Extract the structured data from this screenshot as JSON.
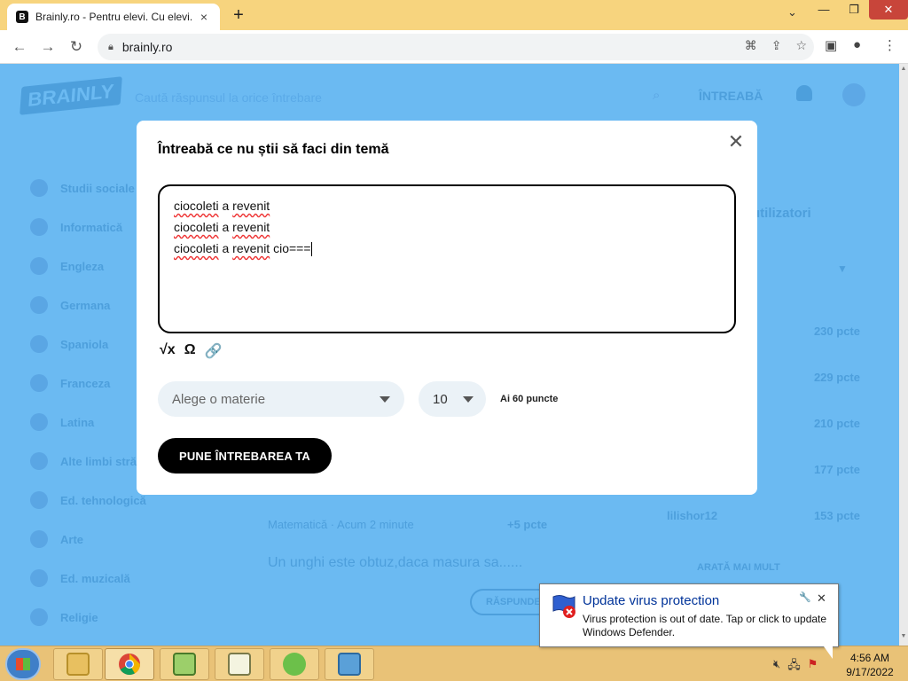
{
  "browser": {
    "tab_title": "Brainly.ro - Pentru elevi. Cu elevi.",
    "tab_favicon": "B",
    "tab_close": "×",
    "new_tab": "+",
    "url": "brainly.ro",
    "window_controls": {
      "minimize": "—",
      "restore": "❐",
      "close": "✕"
    },
    "tab_dropdown": "⌄",
    "nav": {
      "back": "←",
      "forward": "→",
      "reload": "↻"
    },
    "omni_icons": {
      "translate": "⌘",
      "share": "⇪",
      "bookmark": "☆"
    },
    "right_icons": {
      "sidepanel": "▣",
      "profile": "●",
      "menu": "⋮"
    }
  },
  "page": {
    "logo": "BRAINLY",
    "search_placeholder": "Caută răspunsul la orice întrebare",
    "ask_button": "ÎNTREABĂ",
    "subjects": [
      {
        "label": "Studii sociale",
        "icon": "social-icon"
      },
      {
        "label": "Informatică",
        "icon": "computer-icon"
      },
      {
        "label": "Engleza",
        "icon": "english-icon"
      },
      {
        "label": "Germana",
        "icon": "german-icon"
      },
      {
        "label": "Spaniola",
        "icon": "spanish-icon"
      },
      {
        "label": "Franceza",
        "icon": "french-icon"
      },
      {
        "label": "Latina",
        "icon": "latin-icon"
      },
      {
        "label": "Alte limbi străine",
        "icon": "languages-icon"
      },
      {
        "label": "Ed. tehnologică",
        "icon": "tech-icon"
      },
      {
        "label": "Arte",
        "icon": "art-icon"
      },
      {
        "label": "Ed. muzicală",
        "icon": "music-icon"
      },
      {
        "label": "Religie",
        "icon": "religion-icon"
      }
    ],
    "right_header": "utilizatori",
    "ranking_points": [
      "230 pcte",
      "229 pcte",
      "210 pcte",
      "177 pcte",
      "153 pcte"
    ],
    "ranking_name": "lilishor12",
    "question_meta": "Matematică · Acum 2 minute",
    "question_points": "+5 pcte",
    "question_preview": "Un unghi este obtuz,daca masura sa......",
    "answer_button": "RĂSPUNDE",
    "show_more": "ARATĂ MAI MULT"
  },
  "modal": {
    "title": "Întreabă ce nu știi să faci din temă",
    "close": "✕",
    "lines": [
      {
        "w1": "ciocoleti",
        "mid": " a ",
        "w2": "revenit",
        "tail": ""
      },
      {
        "w1": "ciocoleti",
        "mid": " a ",
        "w2": "revenit",
        "tail": ""
      },
      {
        "w1": "ciocoleti",
        "mid": " a ",
        "w2": "revenit",
        "tail": " cio==="
      }
    ],
    "tools": {
      "math": "√x",
      "symbols": "Ω",
      "attach": "🔗"
    },
    "subject_placeholder": "Alege o materie",
    "points_value": "10",
    "points_info": "Ai 60 puncte",
    "submit": "PUNE ÎNTREBAREA TA"
  },
  "notification": {
    "title": "Update virus protection",
    "body": "Virus protection is out of date. Tap or click to update Windows Defender.",
    "close": "✕",
    "pin": "🔧"
  },
  "taskbar": {
    "time": "4:56 AM",
    "date": "9/17/2022"
  },
  "colors": {
    "page_overlay": "#6bbaf2",
    "titlebar": "#f7d47e",
    "taskbar": "#e9c277",
    "submit_bg": "#000000",
    "notification_title": "#003399"
  }
}
